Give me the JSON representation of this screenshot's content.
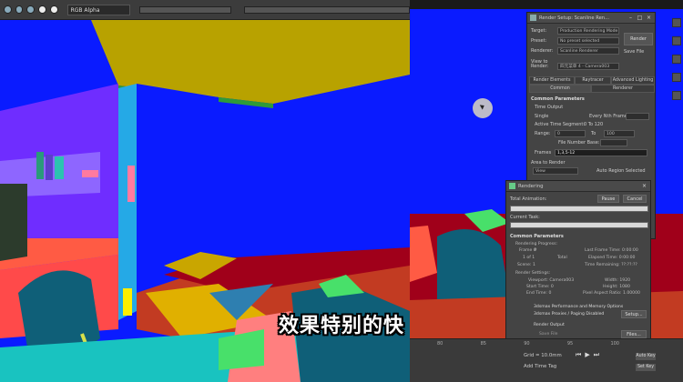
{
  "frame_buffer": {
    "channel_select": "RGB Alpha"
  },
  "render_setup": {
    "title": "Render Setup: Scanline Ren...",
    "target_label": "Target:",
    "target_value": "Production Rendering Mode",
    "preset_label": "Preset:",
    "preset_value": "No preset selected",
    "renderer_label": "Renderer:",
    "renderer_value": "Scanline Renderer",
    "save_file_label": "Save File",
    "render_button": "Render",
    "view_label": "View to Render:",
    "view_value": "四元菜单 4 - Camera003",
    "tabs_row1": [
      "Render Elements",
      "Raytracer",
      "Advanced Lighting"
    ],
    "tabs_row2": [
      "Common",
      "Renderer"
    ],
    "section": "Common Parameters",
    "time_output": "Time Output",
    "single": "Single",
    "every_nth": "Every Nth Frame:",
    "active_segment": "Active Time Segment:",
    "active_segment_value": "0 To 120",
    "range": "Range:",
    "range_from": "0",
    "range_to_label": "To",
    "range_to": "100",
    "file_number_base": "File Number Base:",
    "frames_label": "Frames",
    "frames_value": "1,3,5-12",
    "area_label": "Area to Render",
    "area_value": "View",
    "auto_region": "Auto Region Selected"
  },
  "rendering": {
    "title": "Rendering",
    "total_animation": "Total Animation:",
    "pause": "Pause",
    "cancel": "Cancel",
    "current_task": "Current Task:",
    "common_params": "Common Parameters",
    "rendering_progress": "Rendering Progress:",
    "frame_label": "Frame #",
    "frame_value": "0",
    "last_frame_time": "Last Frame Time: 0:00:00",
    "of_label": "1 of 1",
    "total_label": "Total",
    "elapsed": "Elapsed Time: 0:00:00",
    "scene_label": "Scene: 1",
    "remaining": "Time Remaining: ??:??:??",
    "render_settings": "Render Settings:",
    "viewport": "Viewport: Camera003",
    "width": "Width: 1920",
    "start_time": "Start Time: 0",
    "height": "Height: 1080",
    "end_time": "End Time: 0",
    "pixel_aspect": "Pixel Aspect Ratio: 1.00000",
    "perf_memory": "3dsmax Performance and Memory Options",
    "proxies": "3dsmax Proxies / Paging Disabled",
    "setup_button": "Setup...",
    "render_output": "Render Output",
    "save_file": "Save File",
    "files_button": "Files..."
  },
  "timeline": {
    "ticks": [
      "80",
      "85",
      "90",
      "95",
      "100"
    ],
    "grid": "Grid = 10.0mm",
    "add_time_tag": "Add Time Tag",
    "auto_key": "Auto Key",
    "set_key": "Set Key"
  },
  "subtitle": "效果特别的快"
}
